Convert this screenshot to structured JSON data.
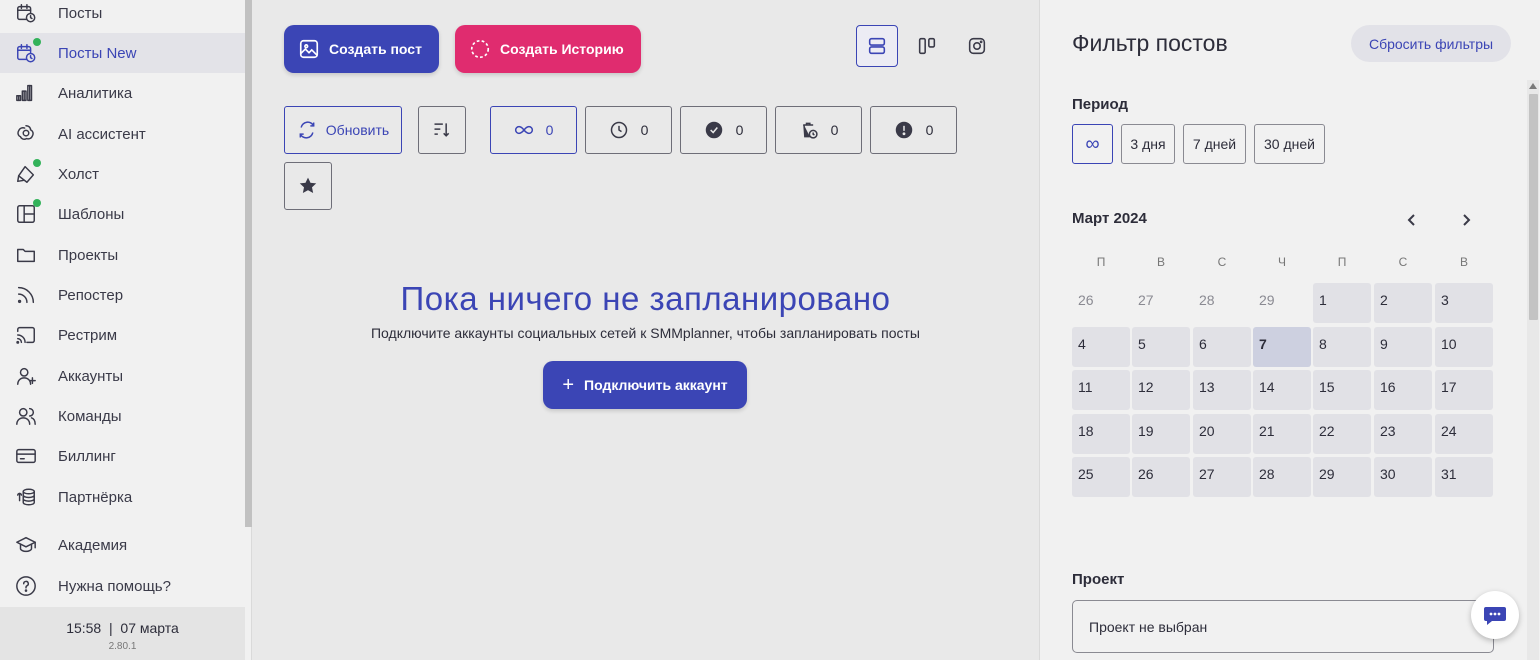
{
  "sidebar": {
    "items": [
      {
        "label": "Посты",
        "icon": "calendar-clock-icon",
        "active": false,
        "dot": false
      },
      {
        "label": "Посты New",
        "icon": "calendar-clock-icon",
        "active": true,
        "dot": true
      },
      {
        "label": "Аналитика",
        "icon": "bar-chart-icon",
        "active": false,
        "dot": false
      },
      {
        "label": "AI ассистент",
        "icon": "ai-assistant-icon",
        "active": false,
        "dot": false
      },
      {
        "label": "Холст",
        "icon": "canvas-icon",
        "active": false,
        "dot": true
      },
      {
        "label": "Шаблоны",
        "icon": "templates-icon",
        "active": false,
        "dot": true
      },
      {
        "label": "Проекты",
        "icon": "folder-icon",
        "active": false,
        "dot": false
      },
      {
        "label": "Репостер",
        "icon": "rss-icon",
        "active": false,
        "dot": false
      },
      {
        "label": "Рестрим",
        "icon": "cast-icon",
        "active": false,
        "dot": false
      },
      {
        "label": "Аккаунты",
        "icon": "user-add-icon",
        "active": false,
        "dot": false
      },
      {
        "label": "Команды",
        "icon": "users-icon",
        "active": false,
        "dot": false
      },
      {
        "label": "Биллинг",
        "icon": "credit-card-icon",
        "active": false,
        "dot": false
      },
      {
        "label": "Партнёрка",
        "icon": "coins-icon",
        "active": false,
        "dot": false
      },
      {
        "label": "Академия",
        "icon": "graduation-cap-icon",
        "active": false,
        "dot": false
      },
      {
        "label": "Нужна помощь?",
        "icon": "help-circle-icon",
        "active": false,
        "dot": false
      }
    ],
    "clock": "15:58  |  07 марта",
    "version": "2.80.1"
  },
  "toolbar": {
    "create_post": "Создать пост",
    "create_story": "Создать Историю",
    "refresh": "Обновить",
    "counters": [
      {
        "icon": "infinity-icon",
        "value": "0"
      },
      {
        "icon": "clock-icon",
        "value": "0"
      },
      {
        "icon": "check-circle-icon",
        "value": "0"
      },
      {
        "icon": "trash-clock-icon",
        "value": "0"
      },
      {
        "icon": "alert-circle-icon",
        "value": "0"
      }
    ]
  },
  "empty_state": {
    "title": "Пока ничего не запланировано",
    "subtitle": "Подключите аккаунты социальных сетей к SMMplanner, чтобы запланировать посты",
    "connect_button": "Подключить аккаунт"
  },
  "filter": {
    "title": "Фильтр постов",
    "reset": "Сбросить фильтры",
    "period_label": "Период",
    "periods": [
      "∞",
      "3 дня",
      "7 дней",
      "30 дней"
    ],
    "month": "Март 2024",
    "weekdays": [
      "П",
      "В",
      "С",
      "Ч",
      "П",
      "С",
      "В"
    ],
    "days": [
      [
        "26",
        "27",
        "28",
        "29",
        "1",
        "2",
        "3"
      ],
      [
        "4",
        "5",
        "6",
        "7",
        "8",
        "9",
        "10"
      ],
      [
        "11",
        "12",
        "13",
        "14",
        "15",
        "16",
        "17"
      ],
      [
        "18",
        "19",
        "20",
        "21",
        "22",
        "23",
        "24"
      ],
      [
        "25",
        "26",
        "27",
        "28",
        "29",
        "30",
        "31"
      ]
    ],
    "today": "7",
    "project_label": "Проект",
    "project_value": "Проект не выбран"
  },
  "colors": {
    "accent": "#3b45b5",
    "story": "#e02c6f",
    "status_dot": "#33b25a"
  }
}
